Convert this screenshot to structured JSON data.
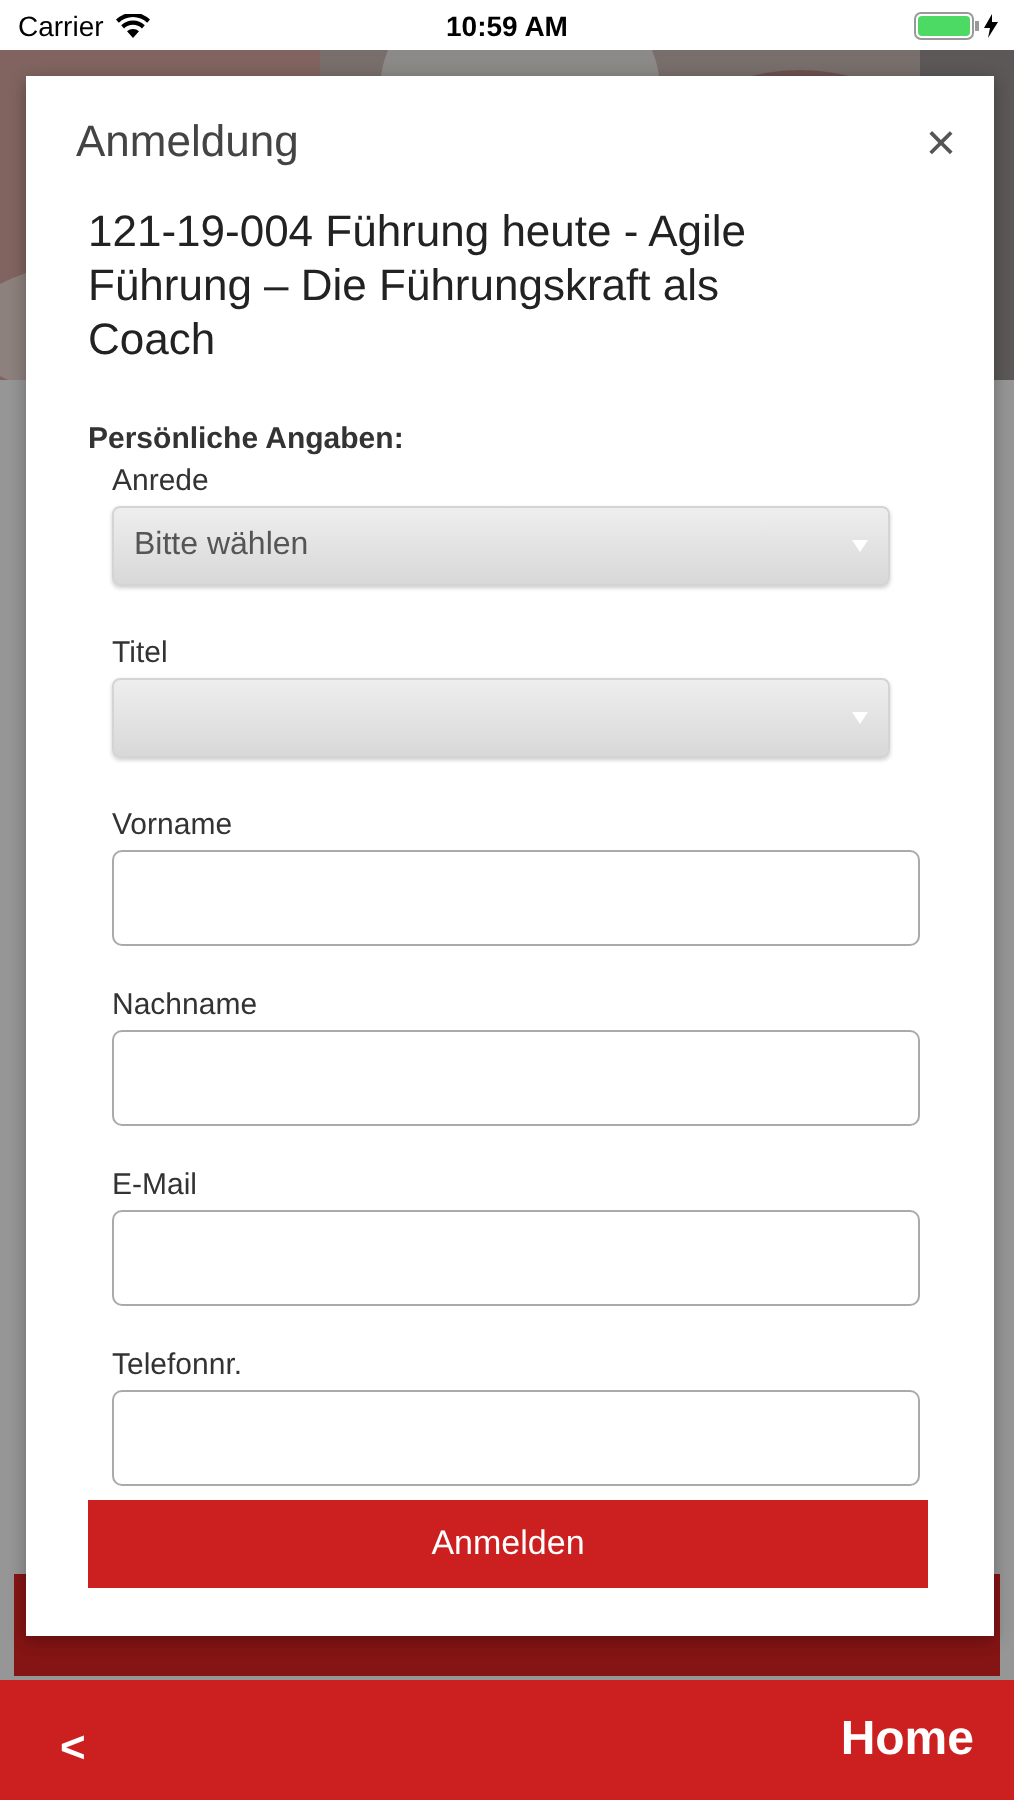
{
  "status_bar": {
    "carrier": "Carrier",
    "time": "10:59 AM"
  },
  "dialog": {
    "title": "Anmeldung",
    "close": "×",
    "heading": "121-19-004 Führung heute - Agile Führung – Die Führungskraft als Coach",
    "section": "Persönliche Angaben:",
    "fields": [
      {
        "kind": "select",
        "label": "Anrede",
        "value": "Bitte wählen"
      },
      {
        "kind": "select",
        "label": "Titel"
      },
      {
        "kind": "text",
        "label": "Vorname"
      },
      {
        "kind": "text",
        "label": "Nachname"
      },
      {
        "kind": "text",
        "label": "E-Mail"
      },
      {
        "kind": "text",
        "label": "Telefonnr."
      }
    ],
    "submit": "Anmelden"
  },
  "nav_bar": {
    "back": "<",
    "home": "Home"
  }
}
